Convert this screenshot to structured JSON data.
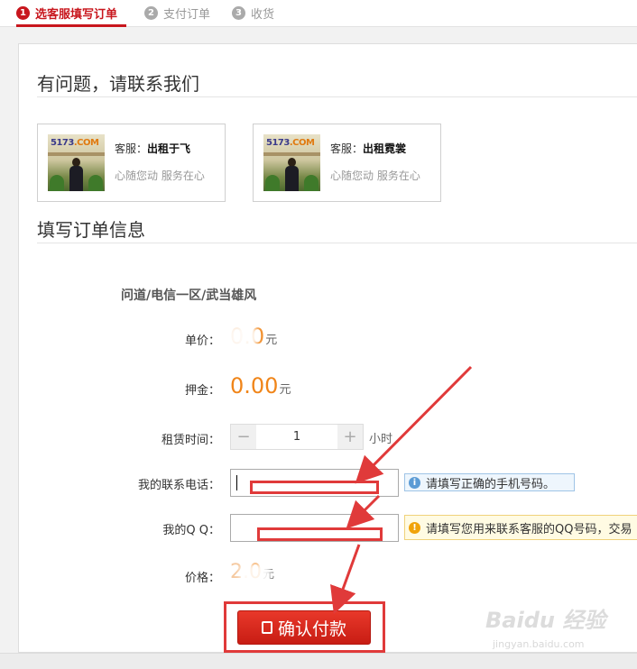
{
  "steps": [
    {
      "num": "1",
      "label": "选客服填写订单",
      "active": true
    },
    {
      "num": "2",
      "label": "支付订单",
      "active": false
    },
    {
      "num": "3",
      "label": "收货",
      "active": false
    }
  ],
  "contact": {
    "title": "有问题，请联系我们",
    "agents": [
      {
        "prefix": "客服：",
        "name": "出租于飞",
        "slogan": "心随您动 服务在心",
        "logo_a": "5173",
        "logo_b": ".COM"
      },
      {
        "prefix": "客服：",
        "name": "出租霓裳",
        "slogan": "心随您动 服务在心",
        "logo_a": "5173",
        "logo_b": ".COM"
      }
    ]
  },
  "order": {
    "title": "填写订单信息",
    "product": "问道/电信一区/武当雄风",
    "unit_price_label": "单价：",
    "unit_price_value": "0",
    "unit_price_unit": "元",
    "deposit_label": "押金：",
    "deposit_value": "0.00",
    "deposit_unit": "元",
    "rent_time_label": "租赁时间：",
    "rent_minus": "−",
    "rent_value": "1",
    "rent_plus": "+",
    "rent_unit": "小时",
    "phone_label": "我的联系电话：",
    "phone_value": "",
    "phone_tip": "请填写正确的手机号码。",
    "qq_label": "我的Q Q：",
    "qq_value": "",
    "qq_tip": "请填写您用来联系客服的QQ号码，交易",
    "total_label": "价格：",
    "total_value": "2.",
    "total_value_tail": "0",
    "total_unit": "元",
    "pay_button": "确认付款"
  },
  "watermark": {
    "main": "Baidu 经验",
    "sub": "jingyan.baidu.com"
  },
  "colors": {
    "accent": "#c8161d",
    "price": "#f08519",
    "annotation": "#e03a3a"
  }
}
